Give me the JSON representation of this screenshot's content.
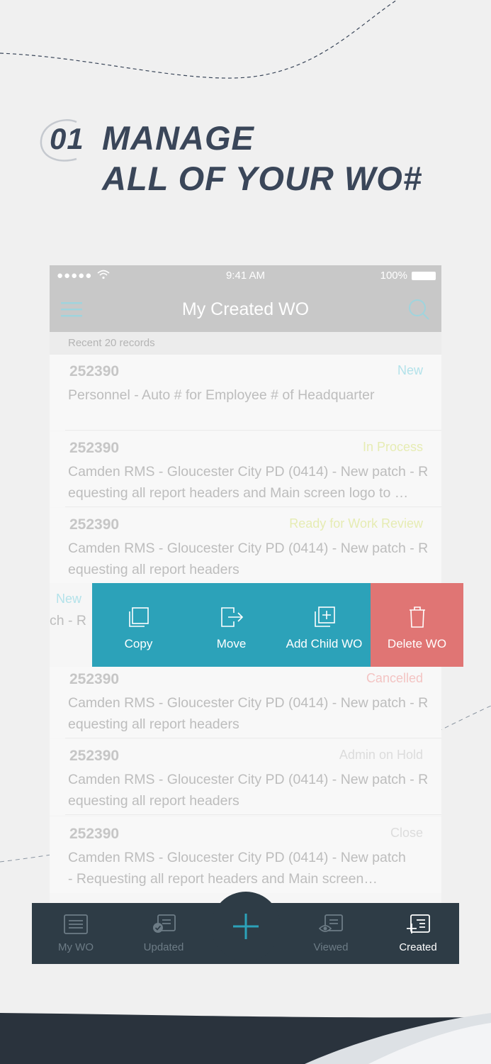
{
  "headline": {
    "step": "01",
    "line1": "MANAGE",
    "line2": "ALL OF YOUR WO#"
  },
  "status_bar": {
    "signal": "●●●●●",
    "time": "9:41 AM",
    "battery": "100%"
  },
  "nav": {
    "title": "My Created WO",
    "menu_icon": "hamburger-menu-icon",
    "search_icon": "search-icon"
  },
  "recent_label": "Recent 20 records",
  "work_orders": [
    {
      "number": "252390",
      "status": "New",
      "status_color": "#b3e2ea",
      "line1": "Personnel - Auto # for Employee # of Headquarter",
      "line2": ""
    },
    {
      "number": "252390",
      "status": "In Process",
      "status_color": "#e6ecb3",
      "line1": "Camden RMS - Gloucester City PD (0414) - New patch - R",
      "line2": "equesting all report headers and Main screen logo to …"
    },
    {
      "number": "252390",
      "status": "Ready for Work Review",
      "status_color": "#e6ecb3",
      "line1": "Camden RMS - Gloucester City PD (0414) - New patch - R",
      "line2": "equesting all report headers"
    },
    {
      "number": "252390",
      "status": "Cancelled",
      "status_color": "#f3c4c3",
      "line1": "Camden RMS - Gloucester City PD (0414) - New patch - R",
      "line2": "equesting all report headers"
    },
    {
      "number": "252390",
      "status": "Admin on Hold",
      "status_color": "#dcdcdc",
      "line1": "Camden RMS - Gloucester City PD (0414) - New patch - R",
      "line2": "equesting all report headers"
    },
    {
      "number": "252390",
      "status": "Close",
      "status_color": "#dcdcdc",
      "line1": "Camden RMS - Gloucester City PD (0414) - New patch",
      "line2": "- Requesting all report headers and Main screen…"
    }
  ],
  "swiped_row": {
    "status": "New",
    "text_fragment": "ch - R"
  },
  "swipe_actions": [
    {
      "label": "Copy",
      "icon": "copy-icon",
      "color": "#2ca2b9"
    },
    {
      "label": "Move",
      "icon": "move-icon",
      "color": "#2ca2b9"
    },
    {
      "label": "Add Child WO",
      "icon": "add-child-icon",
      "color": "#2ca2b9"
    },
    {
      "label": "Delete WO",
      "icon": "trash-icon",
      "color": "#e07574"
    }
  ],
  "tabs": [
    {
      "label": "My WO",
      "icon": "document-icon",
      "active": false
    },
    {
      "label": "Updated",
      "icon": "updated-document-icon",
      "active": false
    },
    {
      "label": "Viewed",
      "icon": "viewed-document-icon",
      "active": false
    },
    {
      "label": "Created",
      "icon": "created-document-icon",
      "active": true
    }
  ],
  "fab_icon": "plus-icon",
  "colors": {
    "accent": "#2ca2b9",
    "danger": "#e07574",
    "navy": "#3a4659",
    "tabbar": "#2e3c46"
  }
}
